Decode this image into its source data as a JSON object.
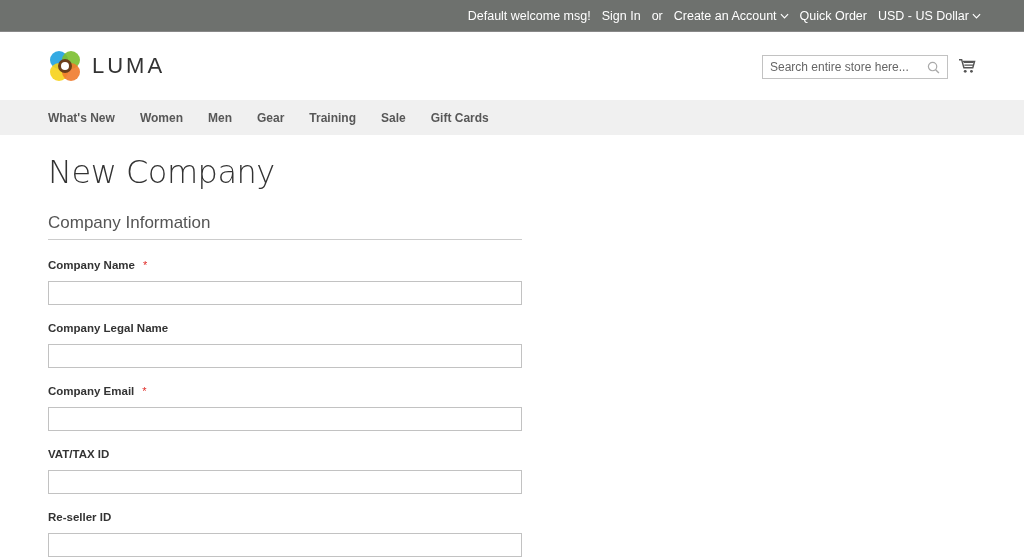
{
  "top_bar": {
    "welcome": "Default welcome msg!",
    "sign_in": "Sign In",
    "or": "or",
    "create_account": "Create an Account",
    "quick_order": "Quick Order",
    "currency": "USD - US Dollar"
  },
  "header": {
    "logo_text": "LUMA",
    "search": {
      "placeholder": "Search entire store here..."
    }
  },
  "nav": [
    "What's New",
    "Women",
    "Men",
    "Gear",
    "Training",
    "Sale",
    "Gift Cards"
  ],
  "page_title": "New Company",
  "section_title": "Company Information",
  "fields": [
    {
      "label": "Company Name",
      "required_mark": "*"
    },
    {
      "label": "Company Legal Name"
    },
    {
      "label": "Company Email",
      "required_mark": "*"
    },
    {
      "label": "VAT/TAX ID"
    },
    {
      "label": "Re-seller ID"
    }
  ]
}
